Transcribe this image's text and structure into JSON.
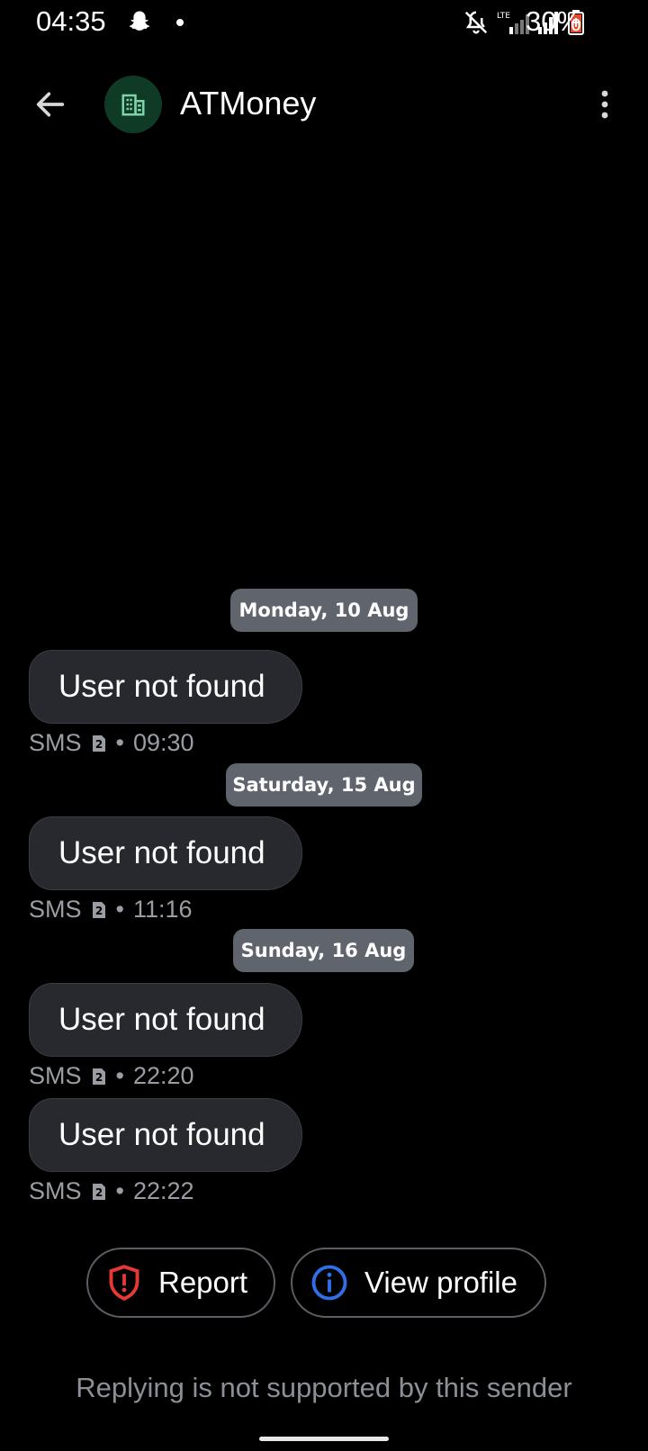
{
  "status_bar": {
    "time": "04:35",
    "battery_percent": "30%",
    "network_label": "LTE",
    "icons": [
      "snapchat-icon",
      "notification-dot",
      "mute-bell-icon",
      "lte-signal-icon",
      "signal-icon",
      "battery-icon"
    ]
  },
  "header": {
    "title": "ATMoney",
    "avatar_icon": "business-building-icon",
    "accent": "#0f3a26"
  },
  "conversation": {
    "dates": [
      {
        "label": "Monday, 10 Aug"
      },
      {
        "label": "Saturday, 15 Aug"
      },
      {
        "label": "Sunday, 16 Aug"
      }
    ],
    "messages": [
      {
        "text": "User not found",
        "channel": "SMS",
        "sim": "2",
        "time": "09:30"
      },
      {
        "text": "User not found",
        "channel": "SMS",
        "sim": "2",
        "time": "11:16"
      },
      {
        "text": "User not found",
        "channel": "SMS",
        "sim": "2",
        "time": "22:20"
      },
      {
        "text": "User not found",
        "channel": "SMS",
        "sim": "2",
        "time": "22:22"
      }
    ]
  },
  "actions": {
    "report_label": "Report",
    "view_profile_label": "View profile"
  },
  "footer": {
    "notice": "Replying is not supported by this sender"
  },
  "colors": {
    "background": "#000000",
    "bubble": "#27292e",
    "chip": "#5f646d",
    "report_red": "#e53935",
    "info_blue": "#2f6fe8"
  }
}
